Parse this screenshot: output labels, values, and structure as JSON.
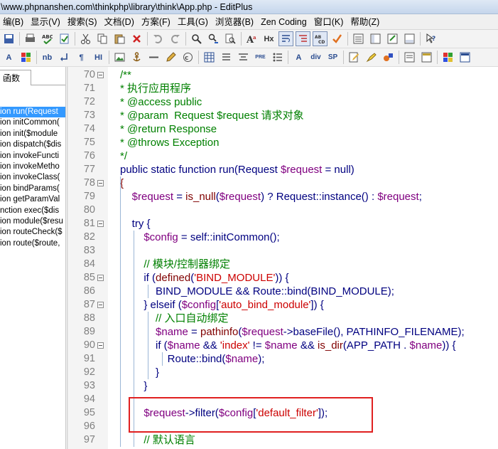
{
  "window": {
    "title": "\\www.phpnanshen.com\\thinkphp\\library\\think\\App.php - EditPlus"
  },
  "menu": [
    "编(B)",
    "显示(V)",
    "搜索(S)",
    "文档(D)",
    "方案(F)",
    "工具(G)",
    "浏览器(B)",
    "Zen Coding",
    "窗口(K)",
    "帮助(Z)"
  ],
  "toolbar2_labels": {
    "a": "A",
    "nb": "nb",
    "pilcrow": "¶",
    "hi": "HI",
    "pre": "PRE",
    "a2": "A",
    "div": "div",
    "sp": "SP"
  },
  "toolbar1_labels": {
    "hx": "Hx"
  },
  "sidebar": {
    "tab": "函数",
    "items": [
      "ion run(Request",
      "ion initCommon(",
      "ion init($module",
      "ion dispatch($dis",
      "ion invokeFuncti",
      "ion invokeMetho",
      "ion invokeClass(",
      "ion bindParams(",
      "ion getParamVal",
      "nction exec($dis",
      "ion module($resu",
      "ion routeCheck($",
      "ion route($route,"
    ],
    "selected_index": 0
  },
  "colors": {
    "highlight_box": "#e02020",
    "selection": "#3399ff",
    "comment": "#008000",
    "variable": "#800080",
    "string": "#cc0000"
  },
  "code": {
    "lines": [
      {
        "n": "70",
        "fold": true,
        "segs": [
          [
            "c",
            "/**"
          ]
        ]
      },
      {
        "n": "71",
        "fold": false,
        "segs": [
          [
            "c",
            "* 执行应用程序"
          ]
        ]
      },
      {
        "n": "72",
        "fold": false,
        "segs": [
          [
            "c",
            "* @access public"
          ]
        ]
      },
      {
        "n": "73",
        "fold": false,
        "segs": [
          [
            "c",
            "* @param  Request $request 请求对象"
          ]
        ]
      },
      {
        "n": "74",
        "fold": false,
        "segs": [
          [
            "c",
            "* @return Response"
          ]
        ]
      },
      {
        "n": "75",
        "fold": false,
        "segs": [
          [
            "c",
            "* @throws Exception"
          ]
        ]
      },
      {
        "n": "76",
        "fold": false,
        "segs": [
          [
            "c",
            "*/"
          ]
        ]
      },
      {
        "n": "77",
        "fold": false,
        "segs": [
          [
            "d",
            "public static function run(Request "
          ],
          [
            "v",
            "$request"
          ],
          [
            "d",
            " = null)"
          ]
        ]
      },
      {
        "n": "78",
        "fold": true,
        "segs": [
          [
            "f",
            "{"
          ]
        ]
      },
      {
        "n": "79",
        "fold": false,
        "segs": [
          [
            "d",
            "    "
          ],
          [
            "v",
            "$request"
          ],
          [
            "d",
            " = "
          ],
          [
            "f",
            "is_null"
          ],
          [
            "d",
            "("
          ],
          [
            "v",
            "$request"
          ],
          [
            "d",
            ") ? Request::instance() : "
          ],
          [
            "v",
            "$request"
          ],
          [
            "d",
            ";"
          ]
        ]
      },
      {
        "n": "80",
        "fold": false,
        "segs": []
      },
      {
        "n": "81",
        "fold": true,
        "segs": [
          [
            "d",
            "    try {"
          ]
        ]
      },
      {
        "n": "82",
        "fold": false,
        "segs": [
          [
            "d",
            "        "
          ],
          [
            "v",
            "$config"
          ],
          [
            "d",
            " = self::initCommon();"
          ]
        ]
      },
      {
        "n": "83",
        "fold": false,
        "segs": []
      },
      {
        "n": "84",
        "fold": false,
        "segs": [
          [
            "d",
            "        "
          ],
          [
            "c",
            "// 模块/控制器绑定"
          ]
        ]
      },
      {
        "n": "85",
        "fold": true,
        "segs": [
          [
            "d",
            "        if ("
          ],
          [
            "f",
            "defined"
          ],
          [
            "d",
            "("
          ],
          [
            "s",
            "'BIND_MODULE'"
          ],
          [
            "d",
            ")) {"
          ]
        ]
      },
      {
        "n": "86",
        "fold": false,
        "segs": [
          [
            "d",
            "            BIND_MODULE && Route::bind(BIND_MODULE);"
          ]
        ]
      },
      {
        "n": "87",
        "fold": true,
        "segs": [
          [
            "d",
            "        } elseif ("
          ],
          [
            "v",
            "$config"
          ],
          [
            "d",
            "["
          ],
          [
            "s",
            "'auto_bind_module'"
          ],
          [
            "d",
            "]) {"
          ]
        ]
      },
      {
        "n": "88",
        "fold": false,
        "segs": [
          [
            "d",
            "            "
          ],
          [
            "c",
            "// 入口自动绑定"
          ]
        ]
      },
      {
        "n": "89",
        "fold": false,
        "segs": [
          [
            "d",
            "            "
          ],
          [
            "v",
            "$name"
          ],
          [
            "d",
            " = "
          ],
          [
            "f",
            "pathinfo"
          ],
          [
            "d",
            "("
          ],
          [
            "v",
            "$request"
          ],
          [
            "d",
            "->baseFile(), PATHINFO_FILENAME);"
          ]
        ]
      },
      {
        "n": "90",
        "fold": true,
        "segs": [
          [
            "d",
            "            if ("
          ],
          [
            "v",
            "$name"
          ],
          [
            "d",
            " && "
          ],
          [
            "s",
            "'index'"
          ],
          [
            "d",
            " != "
          ],
          [
            "v",
            "$name"
          ],
          [
            "d",
            " && "
          ],
          [
            "f",
            "is_dir"
          ],
          [
            "d",
            "(APP_PATH . "
          ],
          [
            "v",
            "$name"
          ],
          [
            "d",
            ")) {"
          ]
        ]
      },
      {
        "n": "91",
        "fold": false,
        "segs": [
          [
            "d",
            "                Route::bind("
          ],
          [
            "v",
            "$name"
          ],
          [
            "d",
            ");"
          ]
        ]
      },
      {
        "n": "92",
        "fold": false,
        "segs": [
          [
            "d",
            "            }"
          ]
        ]
      },
      {
        "n": "93",
        "fold": false,
        "segs": [
          [
            "d",
            "        }"
          ]
        ]
      },
      {
        "n": "94",
        "fold": false,
        "segs": []
      },
      {
        "n": "95",
        "fold": false,
        "segs": [
          [
            "d",
            "        "
          ],
          [
            "v",
            "$request"
          ],
          [
            "d",
            "->filter("
          ],
          [
            "v",
            "$config"
          ],
          [
            "d",
            "["
          ],
          [
            "s",
            "'default_filter'"
          ],
          [
            "d",
            "]);"
          ]
        ]
      },
      {
        "n": "96",
        "fold": false,
        "segs": []
      },
      {
        "n": "97",
        "fold": false,
        "segs": [
          [
            "d",
            "        "
          ],
          [
            "c",
            "// 默认语言"
          ]
        ]
      }
    ]
  }
}
